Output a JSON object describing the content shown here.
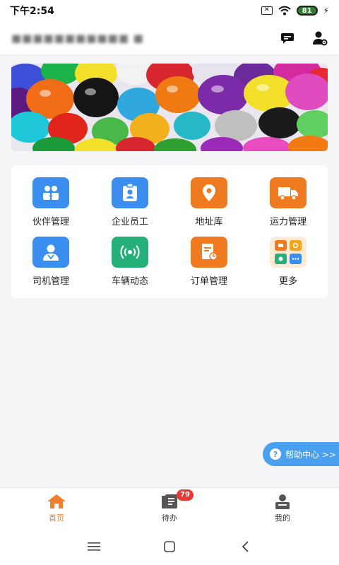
{
  "status_bar": {
    "time": "下午2:54",
    "battery": "81"
  },
  "header": {
    "company_name": "■■■■■■■■■■■ ■",
    "icons": [
      "message-icon",
      "user-settings-icon"
    ]
  },
  "grid": {
    "items": [
      {
        "label": "伙伴管理",
        "icon": "partners-icon",
        "color": "#3a8ef0"
      },
      {
        "label": "企业员工",
        "icon": "employee-badge-icon",
        "color": "#3a8ef0"
      },
      {
        "label": "地址库",
        "icon": "location-pin-icon",
        "color": "#f07a20"
      },
      {
        "label": "运力管理",
        "icon": "truck-icon",
        "color": "#f07a20"
      },
      {
        "label": "司机管理",
        "icon": "driver-icon",
        "color": "#3a8ef0"
      },
      {
        "label": "车辆动态",
        "icon": "signal-broadcast-icon",
        "color": "#25b07a"
      },
      {
        "label": "订单管理",
        "icon": "order-document-icon",
        "color": "#f07a20"
      },
      {
        "label": "更多",
        "icon": "more-apps-icon",
        "color": "#fdebd8"
      }
    ]
  },
  "help": {
    "label": "帮助中心 >>"
  },
  "tabs": [
    {
      "label": "首页",
      "icon": "home-icon",
      "active": true
    },
    {
      "label": "待办",
      "icon": "todo-icon",
      "badge": "79"
    },
    {
      "label": "我的",
      "icon": "profile-icon"
    }
  ],
  "colors": {
    "accent": "#ef7f2c",
    "badge": "#e53935",
    "help": "#4aa0f0"
  }
}
